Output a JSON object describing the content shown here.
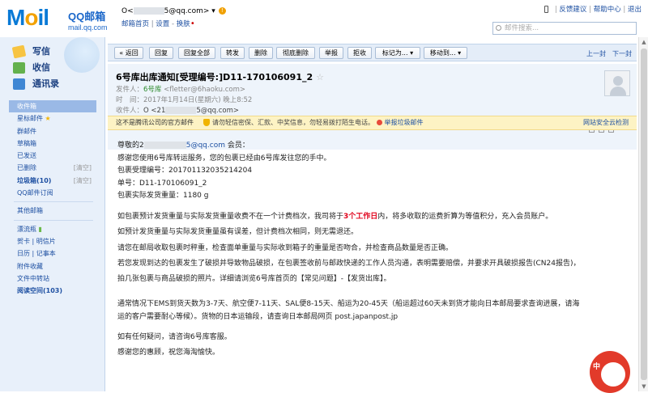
{
  "header": {
    "logo_text": "Mail",
    "logo_brand": "QQ邮箱",
    "logo_domain": "mail.qq.com",
    "account": "O<",
    "account_suffix": "5@qq.com>",
    "account_links": [
      "邮箱首页",
      "设置",
      "换肤"
    ],
    "top_links": [
      "反馈建议",
      "帮助中心",
      "退出"
    ],
    "search_placeholder": "邮件搜索..."
  },
  "sidebar": {
    "compose": "写信",
    "inbox": "收信",
    "contacts": "通讯录",
    "folders": [
      {
        "label": "收件箱",
        "active": true
      },
      {
        "label": "星标邮件"
      },
      {
        "label": "群邮件"
      },
      {
        "label": "草稿箱"
      },
      {
        "label": "已发送"
      },
      {
        "label": "已删除",
        "action": "[清空]"
      },
      {
        "label": "垃圾箱(10)",
        "action": "[清空]",
        "bold": true
      },
      {
        "label": "QQ邮件订阅"
      }
    ],
    "other_folders": [
      {
        "label": "其他邮箱"
      },
      {
        "label": "漂流瓶"
      },
      {
        "label": "贺卡 | 明信片"
      },
      {
        "label": "日历 | 记事本"
      },
      {
        "label": "附件收藏"
      },
      {
        "label": "文件中转站"
      },
      {
        "label": "阅读空间(103)",
        "bold": true
      }
    ]
  },
  "toolbar": {
    "buttons": [
      "« 返回",
      "回复",
      "回复全部",
      "转发",
      "删除",
      "彻底删除",
      "举报",
      "拒收",
      "标记为...",
      "移动到..."
    ],
    "prev": "上一封",
    "next": "下一封"
  },
  "mail": {
    "subject": "6号库出库通知[受理编号:]D11-170106091_2",
    "from_label": "发件人：",
    "from_name": "6号库",
    "from_email": "<fletter@6haoku.com>",
    "time_label": "时　间：",
    "time_value": "2017年1月14日(星期六) 晚上8:52",
    "to_label": "收件人：",
    "to_prefix": "O <21",
    "to_suffix": "5@qq.com>",
    "notice": "这不是腾讯公司的官方邮件",
    "notice_tip": "请勿轻信密保、汇款、中奖信息，勿轻易拨打陌生电话。",
    "notice_report": "举报垃圾邮件",
    "notice_right": "网站安全云检测"
  },
  "body": {
    "greeting_prefix": "尊敬的2",
    "greeting_email": "5@qq.com",
    "greeting_suffix": " 会员：",
    "line1": "感谢您使用6号库转运服务，您的包裹已经由6号库发往您的手中。",
    "line2": "包裹受理编号：201701132035214204",
    "line3": "单号：D11-170106091_2",
    "line4": "包裹实际发货重量：1180 g",
    "p1_a": "如包裹预计发货重量与实际发货重量收费不在一个计费档次，我司将于",
    "p1_red": "3个工作日",
    "p1_b": "内，将多收取的运费折算为等值积分，充入会员账户。",
    "p2": "如预计发货重量与实际发货重量虽有误差，但计费档次相同，则无需退还。",
    "p3": "请您在邮局收取包裹时秤重，检查面单重量与实际收到箱子的重量是否吻合，并检查商品数量是否正确。",
    "p4a": "若您发现到达的包裹发生了破损并导致物品破损，在包裹签收前与邮政快递的工作人员沟通，表明需要赔偿，并要求开具破损报告(CN24报告)，",
    "p4b": "拍几张包裹与商品破损的照片。详细请浏览6号库首页的【常见问题】-【发货出库】。",
    "p5a": "通常情况下EMS到货天数为3-7天、航空便7-11天、SAL便8-15天、船运为20-45天（船运超过60天未到货才能向日本邮局要求查询进展，请海",
    "p5b": "运的客户需要耐心等候）。货物的日本运输段，请查询日本邮局网页 post.japanpost.jp",
    "p6": "如有任何疑问，请咨询6号库客服。",
    "p7": "感谢您的惠顾，祝您海淘愉快。"
  }
}
